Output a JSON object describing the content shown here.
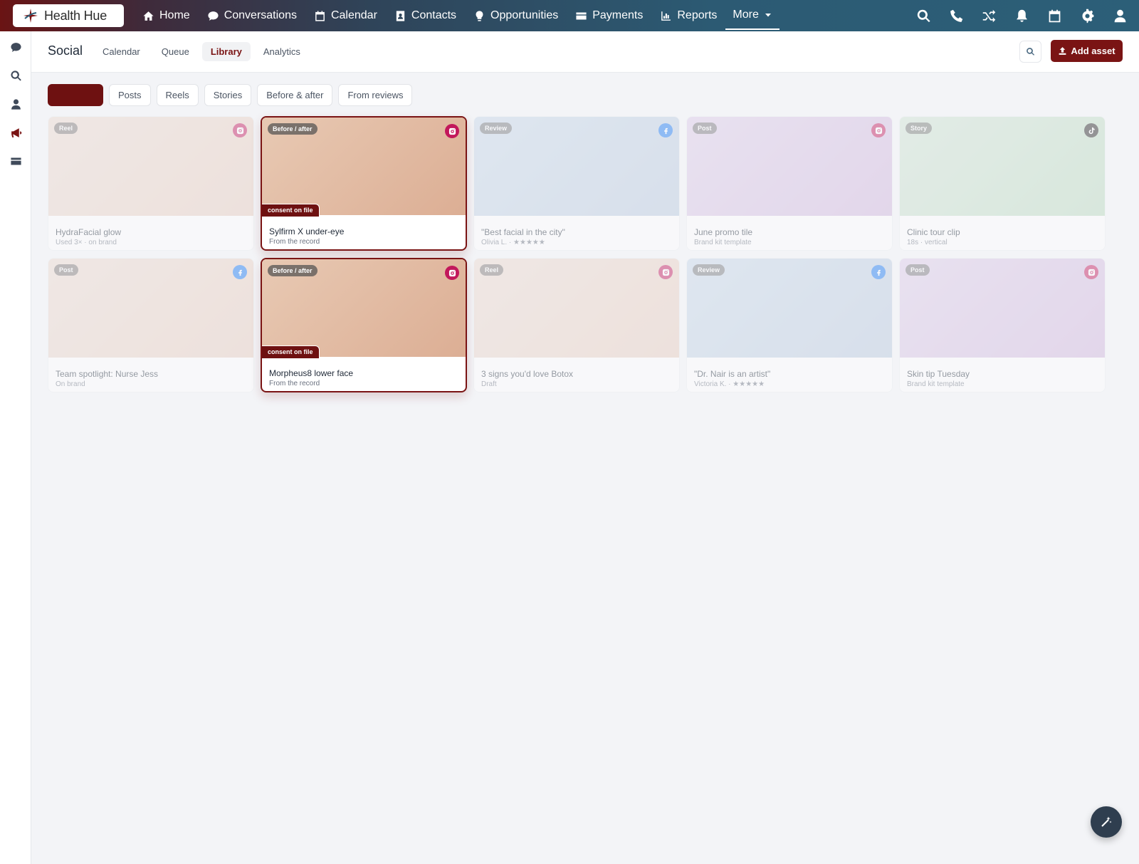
{
  "brand": {
    "name": "Health Hue",
    "accent": "#7a1414"
  },
  "nav": {
    "items": [
      {
        "label": "Home",
        "icon": "home-icon"
      },
      {
        "label": "Conversations",
        "icon": "chat-icon"
      },
      {
        "label": "Calendar",
        "icon": "calendar-icon"
      },
      {
        "label": "Contacts",
        "icon": "contacts-icon"
      },
      {
        "label": "Opportunities",
        "icon": "lightbulb-icon"
      },
      {
        "label": "Payments",
        "icon": "credit-card-icon"
      },
      {
        "label": "Reports",
        "icon": "bar-chart-icon"
      }
    ],
    "more_label": "More",
    "utility_icons": [
      "search-icon",
      "phone-icon",
      "shuffle-icon",
      "bell-icon",
      "calendar-icon",
      "gear-icon",
      "user-icon"
    ]
  },
  "rail": {
    "icons": [
      "chat-icon",
      "search-icon",
      "user-icon",
      "megaphone-icon",
      "card-icon"
    ],
    "active": "megaphone-icon"
  },
  "subheader": {
    "title": "Social",
    "tabs": [
      "Calendar",
      "Queue",
      "Library",
      "Analytics"
    ],
    "active_tab": "Library",
    "add_label": "Add asset"
  },
  "filters": {
    "items": [
      "",
      "Posts",
      "Reels",
      "Stories",
      "Before & after",
      "From reviews"
    ],
    "active_index": 0
  },
  "cards": [
    {
      "tag": "Reel",
      "platform": "instagram",
      "title": "HydraFacial glow",
      "sub": "Used 3× · on brand",
      "bg": "peach",
      "highlight": false
    },
    {
      "tag": "Before / after",
      "platform": "instagram",
      "title": "Sylfirm X under-eye",
      "sub": "From the record",
      "bg": "tan",
      "highlight": true,
      "consent": "consent on file"
    },
    {
      "tag": "Review",
      "platform": "facebook",
      "title": "\"Best facial in the city\"",
      "sub": "Olivia L. · ★★★★★",
      "bg": "blue",
      "highlight": false
    },
    {
      "tag": "Post",
      "platform": "instagram",
      "title": "June promo tile",
      "sub": "Brand kit template",
      "bg": "lilac",
      "highlight": false
    },
    {
      "tag": "Story",
      "platform": "tiktok",
      "title": "Clinic tour clip",
      "sub": "18s · vertical",
      "bg": "green",
      "highlight": false
    },
    {
      "tag": "Post",
      "platform": "facebook",
      "title": "Team spotlight: Nurse Jess",
      "sub": "On brand",
      "bg": "peach",
      "highlight": false
    },
    {
      "tag": "Before / after",
      "platform": "instagram",
      "title": "Morpheus8 lower face",
      "sub": "From the record",
      "bg": "tan",
      "highlight": true,
      "consent": "consent on file"
    },
    {
      "tag": "Reel",
      "platform": "instagram",
      "title": "3 signs you'd love Botox",
      "sub": "Draft",
      "bg": "peach",
      "highlight": false
    },
    {
      "tag": "Review",
      "platform": "facebook",
      "title": "\"Dr. Nair is an artist\"",
      "sub": "Victoria K. · ★★★★★",
      "bg": "blue",
      "highlight": false
    },
    {
      "tag": "Post",
      "platform": "instagram",
      "title": "Skin tip Tuesday",
      "sub": "Brand kit template",
      "bg": "lilac",
      "highlight": false
    }
  ],
  "platform_colors": {
    "instagram": "#c2185b",
    "facebook": "#1877f2",
    "tiktok": "#222222"
  },
  "fab": {
    "icon": "magic-wand-icon"
  }
}
